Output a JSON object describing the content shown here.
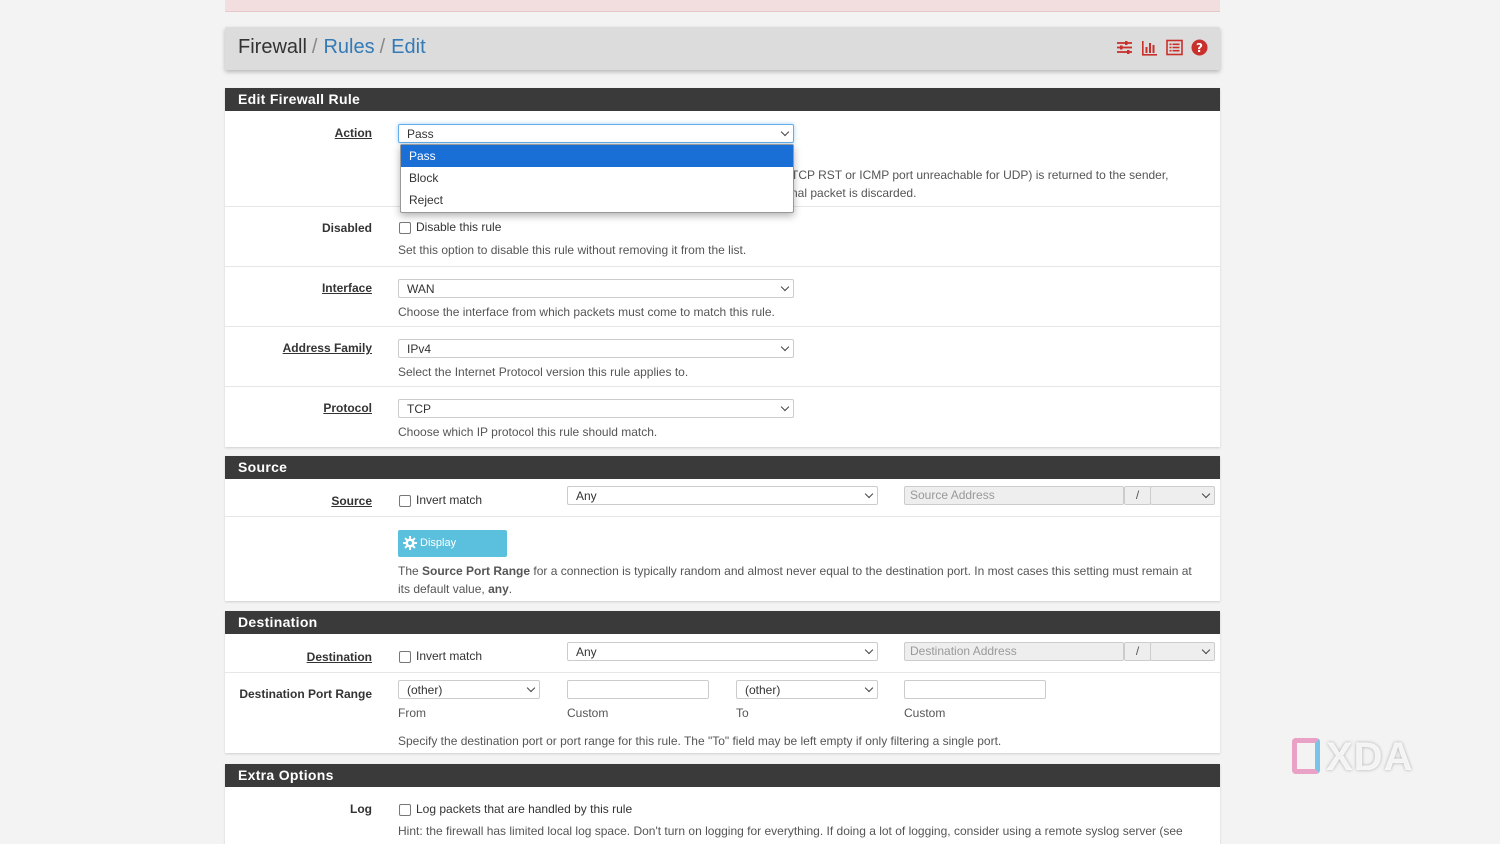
{
  "breadcrumb": {
    "root": "Firewall",
    "sep": "/",
    "rules": "Rules",
    "edit": "Edit"
  },
  "toolbar_icons": [
    "sliders-icon",
    "bar-chart-icon",
    "list-icon",
    "help-icon"
  ],
  "colors": {
    "header_bg": "#3a3a3a",
    "link": "#337ab7",
    "selected_option": "#1a6fd6",
    "advanced_button": "#5bc0de",
    "help_icon": "#c9302c"
  },
  "edit_rule": {
    "title": "Edit Firewall Rule",
    "action": {
      "label": "Action",
      "value": "Pass",
      "options": [
        "Pass",
        "Block",
        "Reject"
      ],
      "help_line1": "TCP RST or ICMP port unreachable for UDP) is returned to the sender,",
      "help_line2": "nal packet is discarded."
    },
    "disabled": {
      "label": "Disabled",
      "checkbox_label": "Disable this rule",
      "help": "Set this option to disable this rule without removing it from the list."
    },
    "interface": {
      "label": "Interface",
      "value": "WAN",
      "help": "Choose the interface from which packets must come to match this rule."
    },
    "address_family": {
      "label": "Address Family",
      "value": "IPv4",
      "help": "Select the Internet Protocol version this rule applies to."
    },
    "protocol": {
      "label": "Protocol",
      "value": "TCP",
      "help": "Choose which IP protocol this rule should match."
    }
  },
  "source": {
    "title": "Source",
    "label": "Source",
    "invert_label": "Invert match",
    "type_value": "Any",
    "address_placeholder": "Source Address",
    "slash": "/",
    "advanced_button": "Display Advanced",
    "help_pre": "The ",
    "help_bold": "Source Port Range",
    "help_post": " for a connection is typically random and almost never equal to the destination port. In most cases this setting must remain at",
    "help_line2_pre": "its default value, ",
    "help_line2_bold": "any",
    "help_line2_post": "."
  },
  "destination": {
    "title": "Destination",
    "label": "Destination",
    "invert_label": "Invert match",
    "type_value": "Any",
    "address_placeholder": "Destination Address",
    "slash": "/",
    "port_range_label": "Destination Port Range",
    "from_value": "(other)",
    "to_value": "(other)",
    "from_caption": "From",
    "custom_caption_1": "Custom",
    "to_caption": "To",
    "custom_caption_2": "Custom",
    "help": "Specify the destination port or port range for this rule. The \"To\" field may be left empty if only filtering a single port."
  },
  "extra": {
    "title": "Extra Options",
    "log_label": "Log",
    "log_checkbox_label": "Log packets that are handled by this rule",
    "log_help": "Hint: the firewall has limited local log space. Don't turn on logging for everything. If doing a lot of logging, consider using a remote syslog server (see"
  },
  "watermark": "XDA"
}
